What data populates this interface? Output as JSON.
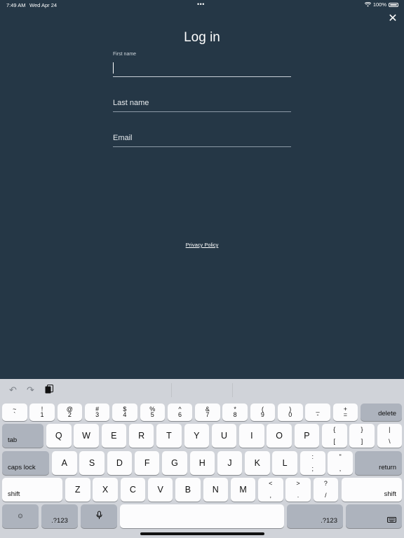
{
  "status_bar": {
    "time": "7:49 AM",
    "date": "Wed Apr 24",
    "dots": "•••",
    "battery": "100%"
  },
  "form": {
    "title": "Log in",
    "first_name_label": "First name",
    "last_name_placeholder": "Last name",
    "email_placeholder": "Email",
    "privacy_link": "Privacy Policy"
  },
  "keyboard": {
    "row1": [
      {
        "top": "~",
        "bot": "`"
      },
      {
        "top": "!",
        "bot": "1"
      },
      {
        "top": "@",
        "bot": "2"
      },
      {
        "top": "#",
        "bot": "3"
      },
      {
        "top": "$",
        "bot": "4"
      },
      {
        "top": "%",
        "bot": "5"
      },
      {
        "top": "^",
        "bot": "6"
      },
      {
        "top": "&",
        "bot": "7"
      },
      {
        "top": "*",
        "bot": "8"
      },
      {
        "top": "(",
        "bot": "9"
      },
      {
        "top": ")",
        "bot": "0"
      },
      {
        "top": "_",
        "bot": "-"
      },
      {
        "top": "+",
        "bot": "="
      }
    ],
    "delete": "delete",
    "tab": "tab",
    "row2": [
      "Q",
      "W",
      "E",
      "R",
      "T",
      "Y",
      "U",
      "I",
      "O",
      "P"
    ],
    "row2_sym": [
      {
        "top": "{",
        "bot": "["
      },
      {
        "top": "}",
        "bot": "]"
      },
      {
        "top": "|",
        "bot": "\\"
      }
    ],
    "caps_lock": "caps lock",
    "row3": [
      "A",
      "S",
      "D",
      "F",
      "G",
      "H",
      "J",
      "K",
      "L"
    ],
    "row3_sym": [
      {
        "top": ":",
        "bot": ";"
      },
      {
        "top": "\"",
        "bot": ","
      }
    ],
    "return": "return",
    "shift": "shift",
    "row4": [
      "Z",
      "X",
      "C",
      "V",
      "B",
      "N",
      "M"
    ],
    "row4_sym": [
      {
        "top": "<",
        "bot": ","
      },
      {
        "top": ">",
        "bot": "."
      },
      {
        "top": "?",
        "bot": "/"
      }
    ],
    "num_left": ".?123",
    "num_right": ".?123"
  }
}
